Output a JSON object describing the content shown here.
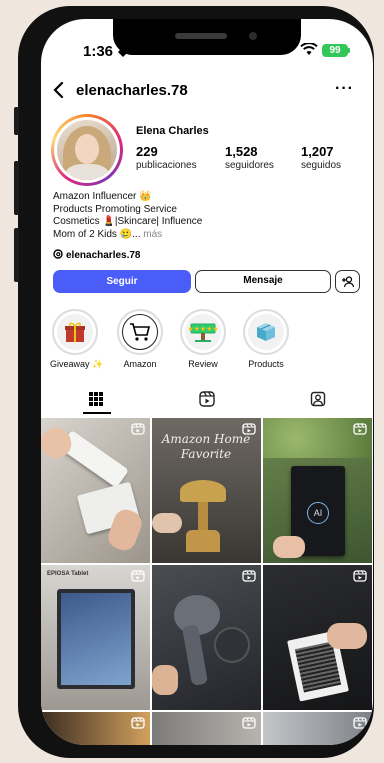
{
  "status_bar": {
    "time": "1:36",
    "battery": "99"
  },
  "header": {
    "username": "elenacharles.78",
    "more": "···"
  },
  "profile": {
    "full_name": "Elena Charles",
    "stats": [
      {
        "count": "229",
        "label": "publicaciones"
      },
      {
        "count": "1,528",
        "label": "seguidores"
      },
      {
        "count": "1,207",
        "label": "seguidos"
      }
    ],
    "bio": [
      "Amazon Influencer 👑",
      "Products Promoting Service",
      "Cosmetics 💄|Skincare| Influence",
      "Mom of 2 Kids 🥲..."
    ],
    "bio_more": "más",
    "threads_handle": "elenacharles.78"
  },
  "actions": {
    "follow": "Seguir",
    "message": "Mensaje"
  },
  "highlights": [
    {
      "label": "Giveaway ✨",
      "icon": "gift-icon"
    },
    {
      "label": "Amazon",
      "icon": "cart-icon"
    },
    {
      "label": "Review",
      "icon": "stars-sign-icon"
    },
    {
      "label": "Products",
      "icon": "box-icon"
    }
  ],
  "tabs": [
    {
      "name": "grid",
      "icon": "grid-icon",
      "active": true
    },
    {
      "name": "reels",
      "icon": "reels-icon",
      "active": false
    },
    {
      "name": "tagged",
      "icon": "tagged-icon",
      "active": false
    }
  ],
  "grid_posts": [
    {
      "overlay": ""
    },
    {
      "overlay": "Amazon Home Favorite"
    },
    {
      "overlay": ""
    },
    {
      "overlay": "EPIOSA Tablet"
    },
    {
      "overlay": ""
    },
    {
      "overlay": ""
    }
  ],
  "colors": {
    "follow_button": "#4a5df9",
    "battery": "#33c759"
  }
}
